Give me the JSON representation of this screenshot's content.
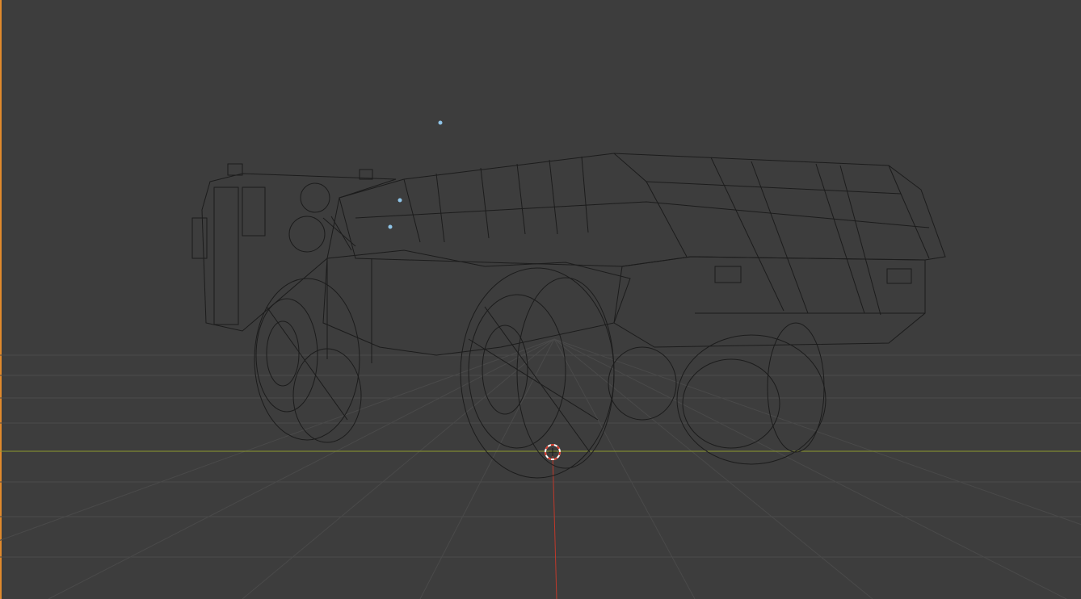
{
  "viewport": {
    "background": "#3d3d3d",
    "grid_color": "#4d4d4d",
    "x_axis_color": "#8f9a2e",
    "y_axis_color": "#c0392b",
    "wire_color": "#1c1c1c",
    "active_border_color": "#e08a2c"
  },
  "scene": {
    "object": "dump-truck-wireframe",
    "cursor_icon": "3d-cursor-icon",
    "light_icon": "light-point-icon"
  }
}
